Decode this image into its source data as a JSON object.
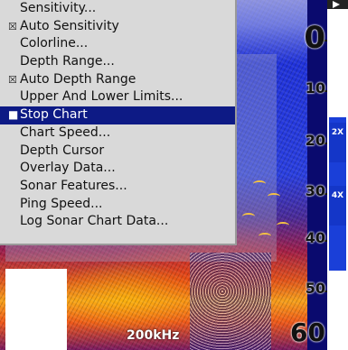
{
  "menu": {
    "items": [
      {
        "label": "Sensitivity...",
        "mark": "",
        "selected": false
      },
      {
        "label": "Auto Sensitivity",
        "mark": "☒",
        "selected": false
      },
      {
        "label": "Colorline...",
        "mark": "",
        "selected": false
      },
      {
        "label": "Depth Range...",
        "mark": "",
        "selected": false
      },
      {
        "label": "Auto Depth Range",
        "mark": "☒",
        "selected": false
      },
      {
        "label": "Upper And Lower Limits...",
        "mark": "",
        "selected": false
      },
      {
        "label": "Stop Chart",
        "mark": "■",
        "selected": true
      },
      {
        "label": "Chart Speed...",
        "mark": "",
        "selected": false
      },
      {
        "label": "Depth Cursor",
        "mark": "",
        "selected": false
      },
      {
        "label": "Overlay Data...",
        "mark": "",
        "selected": false
      },
      {
        "label": "Sonar Features...",
        "mark": "",
        "selected": false
      },
      {
        "label": "Ping Speed...",
        "mark": "",
        "selected": false
      },
      {
        "label": "Log Sonar Chart Data...",
        "mark": "",
        "selected": false
      }
    ]
  },
  "depth_scale": {
    "d0": "0",
    "d10": "10",
    "d20": "20",
    "d30": "30",
    "d40": "40",
    "d50": "50",
    "d60": "60"
  },
  "zoom": {
    "label_2x": "2X",
    "label_4x": "4X"
  },
  "frequency": "200kHz",
  "colors": {
    "menu_bg": "#d9d9d9",
    "selected_bg": "#0d1a85",
    "zoom_bar": "#1436c8"
  },
  "icons": {
    "scroll_arrow": "arrow-right-icon",
    "checkbox": "checkbox-checked-icon",
    "selected_marker": "square-marker-icon"
  }
}
